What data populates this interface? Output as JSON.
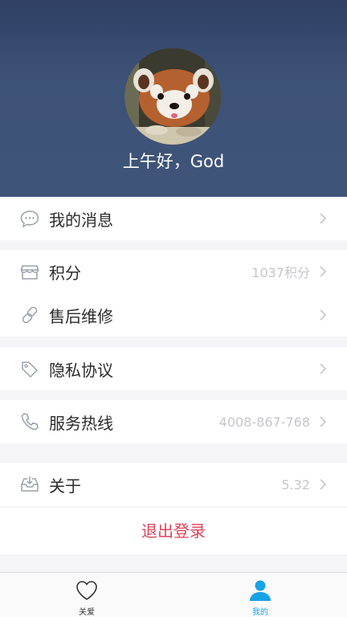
{
  "profile": {
    "greeting": "上午好，God",
    "avatar_alt": "red-panda-avatar"
  },
  "menu": {
    "messages": {
      "label": "我的消息",
      "icon": "chat-bubble-icon"
    },
    "points": {
      "label": "积分",
      "value": "1037积分",
      "icon": "store-icon"
    },
    "repair": {
      "label": "售后维修",
      "icon": "link-chain-icon"
    },
    "privacy": {
      "label": "隐私协议",
      "icon": "tag-icon"
    },
    "hotline": {
      "label": "服务热线",
      "value": "4008-867-768",
      "icon": "phone-icon"
    },
    "about": {
      "label": "关于",
      "value": "5.32",
      "icon": "inbox-download-icon"
    }
  },
  "logout_label": "退出登录",
  "tabbar": {
    "tabs": [
      {
        "label": "关爱",
        "icon": "heart-icon",
        "active": false
      },
      {
        "label": "我的",
        "icon": "person-icon",
        "active": true
      }
    ]
  },
  "colors": {
    "header_bg": "#3d5277",
    "logout_text": "#e0435c",
    "tab_active": "#1aa2e6",
    "tab_inactive": "#333333"
  }
}
